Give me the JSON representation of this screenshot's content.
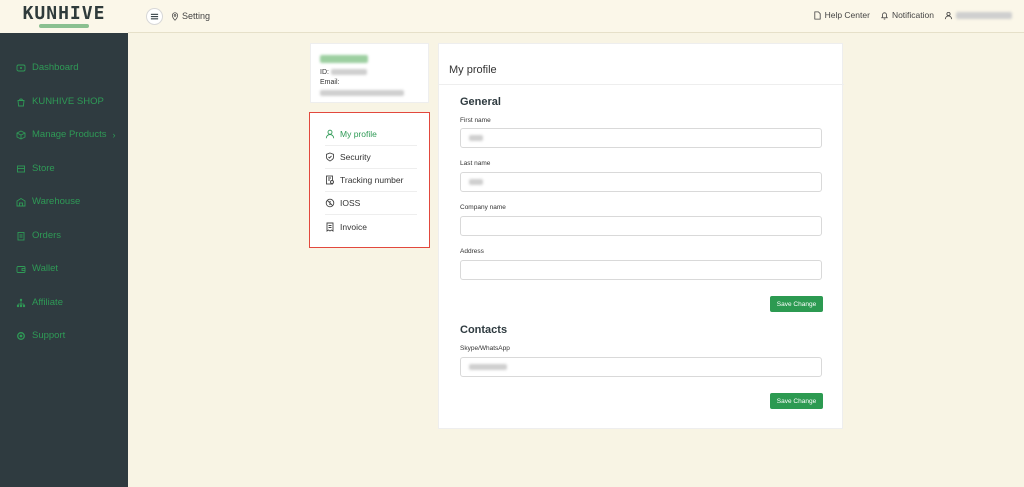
{
  "header": {
    "logo": "KUNHIVE",
    "breadcrumb": "Setting",
    "help_center": "Help Center",
    "notification": "Notification"
  },
  "sidebar": {
    "items": [
      {
        "label": "Dashboard",
        "icon": "dashboard-icon"
      },
      {
        "label": "KUNHIVE SHOP",
        "icon": "shop-bag-icon"
      },
      {
        "label": "Manage Products",
        "icon": "box-icon"
      },
      {
        "label": "Store",
        "icon": "store-icon"
      },
      {
        "label": "Warehouse",
        "icon": "warehouse-icon"
      },
      {
        "label": "Orders",
        "icon": "orders-icon"
      },
      {
        "label": "Wallet",
        "icon": "wallet-icon"
      },
      {
        "label": "Affiliate",
        "icon": "affiliate-icon"
      },
      {
        "label": "Support",
        "icon": "support-icon"
      }
    ]
  },
  "profile_card": {
    "id_label": "ID:",
    "email_label": "Email:"
  },
  "settings_menu": {
    "items": [
      {
        "label": "My profile",
        "icon": "user-icon"
      },
      {
        "label": "Security",
        "icon": "shield-icon"
      },
      {
        "label": "Tracking number",
        "icon": "tracking-icon"
      },
      {
        "label": "IOSS",
        "icon": "ioss-icon"
      },
      {
        "label": "Invoice",
        "icon": "invoice-icon"
      }
    ]
  },
  "main": {
    "title": "My profile",
    "general": {
      "heading": "General",
      "first_name_label": "First name",
      "last_name_label": "Last name",
      "company_name_label": "Company name",
      "address_label": "Address",
      "save_label": "Save Change"
    },
    "contacts": {
      "heading": "Contacts",
      "skype_label": "Skype/WhatsApp",
      "save_label": "Save Change"
    }
  },
  "colors": {
    "accent": "#2c9a51",
    "sidebar_bg": "#2f3b40",
    "highlight_border": "#e2483d",
    "page_bg": "#f8f4e4"
  }
}
